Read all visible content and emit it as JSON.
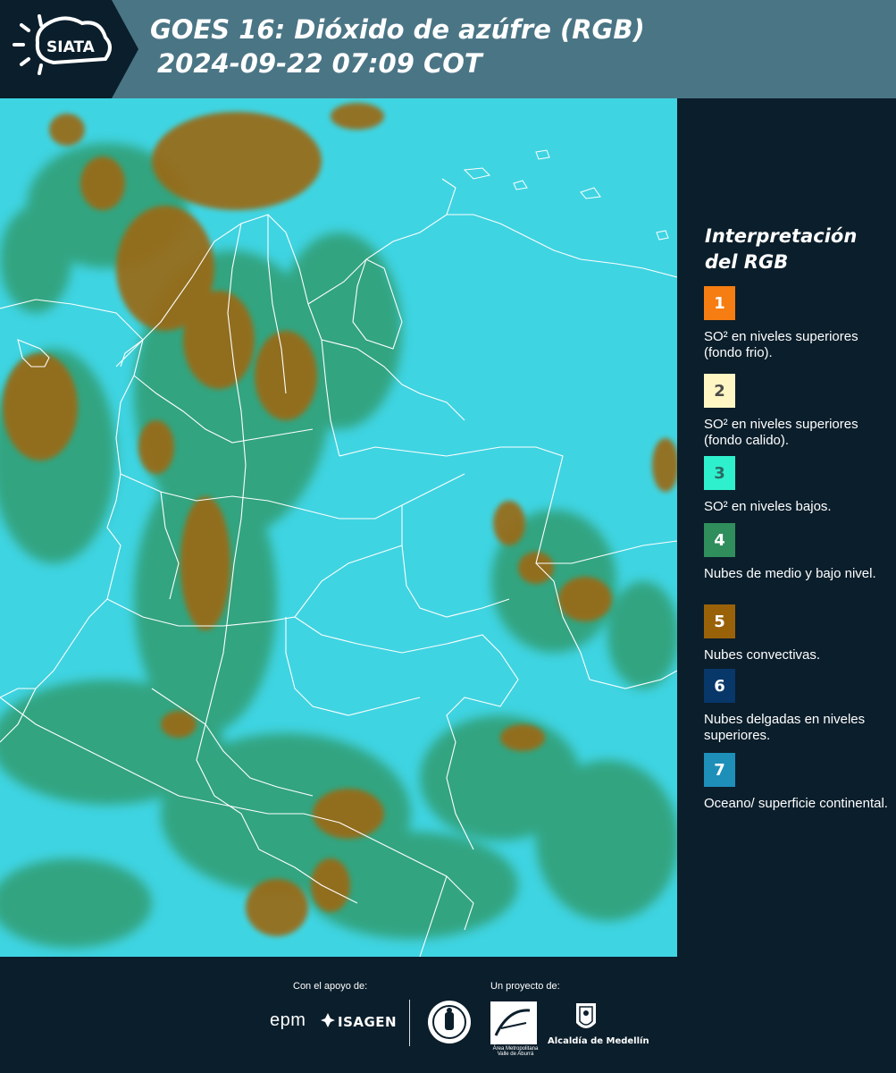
{
  "header": {
    "logo_text": "SIATA",
    "title": "GOES 16: Dióxido de azúfre (RGB)",
    "subtitle": "2024-09-22 07:09 COT"
  },
  "legend": {
    "title": "Interpretación del RGB",
    "items": [
      {
        "number": "1",
        "label": "SO² en niveles superiores (fondo frio).",
        "color": "#f57d12",
        "text_color": "#ffffff"
      },
      {
        "number": "2",
        "label": "SO² en niveles superiores (fondo calido).",
        "color": "#fff6c4",
        "text_color": "#4a4a4a"
      },
      {
        "number": "3",
        "label": "SO² en niveles bajos.",
        "color": "#2ef0cc",
        "text_color": "#2a6b66"
      },
      {
        "number": "4",
        "label": "Nubes de medio y bajo nivel.",
        "color": "#2f8e5c",
        "text_color": "#ffffff"
      },
      {
        "number": "5",
        "label": "Nubes convectivas.",
        "color": "#9a6208",
        "text_color": "#ffffff"
      },
      {
        "number": "6",
        "label": "Nubes delgadas en niveles superiores.",
        "color": "#08376a",
        "text_color": "#ffffff"
      },
      {
        "number": "7",
        "label": "Oceano/ superficie continental.",
        "color": "#1d8fb9",
        "text_color": "#ffffff"
      }
    ]
  },
  "footer": {
    "support_label": "Con el apoyo de:",
    "project_label": "Un proyecto de:",
    "sponsor_1": "epm",
    "sponsor_2": "ISAGEN",
    "partner_1": "Área Metropolitana Valle de Aburrá",
    "partner_2": "Alcaldía de Medellín"
  },
  "colors": {
    "header_bg": "#4a7585",
    "page_bg": "#0b1e2b",
    "ocean": "#3fd4e2",
    "convective": "#9a6a14",
    "low_cloud": "#2f9460",
    "border_lines": "#ffffff"
  }
}
